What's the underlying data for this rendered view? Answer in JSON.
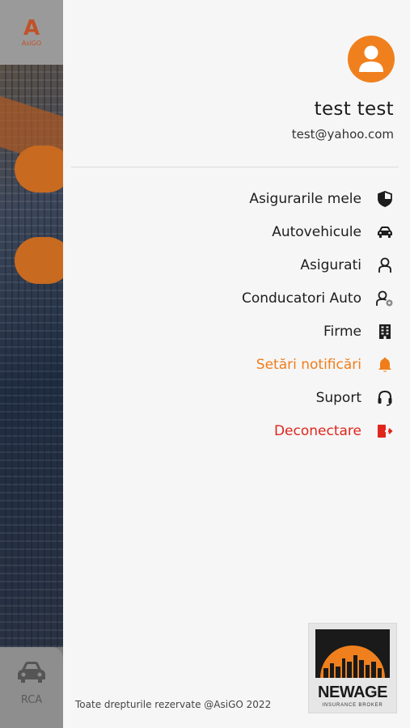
{
  "background": {
    "logo_mark": "A",
    "logo_text": "AsiGO",
    "tab_label": "RCA",
    "tab_icon": "car-icon"
  },
  "drawer": {
    "user": {
      "name": "test test",
      "email": "test@yahoo.com",
      "avatar_icon": "user-avatar-icon"
    },
    "menu": [
      {
        "label": "Asigurarile mele",
        "icon": "shield-icon",
        "variant": "default"
      },
      {
        "label": "Autovehicule",
        "icon": "car-icon",
        "variant": "default"
      },
      {
        "label": "Asigurati",
        "icon": "person-outline-icon",
        "variant": "default"
      },
      {
        "label": "Conducatori Auto",
        "icon": "driver-icon",
        "variant": "default"
      },
      {
        "label": "Firme",
        "icon": "building-icon",
        "variant": "default"
      },
      {
        "label": "Setări notificări",
        "icon": "bell-icon",
        "variant": "accent"
      },
      {
        "label": "Suport",
        "icon": "headset-icon",
        "variant": "default"
      },
      {
        "label": "Deconectare",
        "icon": "logout-icon",
        "variant": "danger"
      }
    ],
    "footer": "Toate drepturile rezervate @AsiGO 2022",
    "brand": {
      "name": "NEWAGE",
      "tagline": "INSURANCE  BROKER"
    }
  },
  "colors": {
    "accent": "#f07d1a",
    "danger": "#e0261c",
    "text": "#1d1d1d"
  }
}
